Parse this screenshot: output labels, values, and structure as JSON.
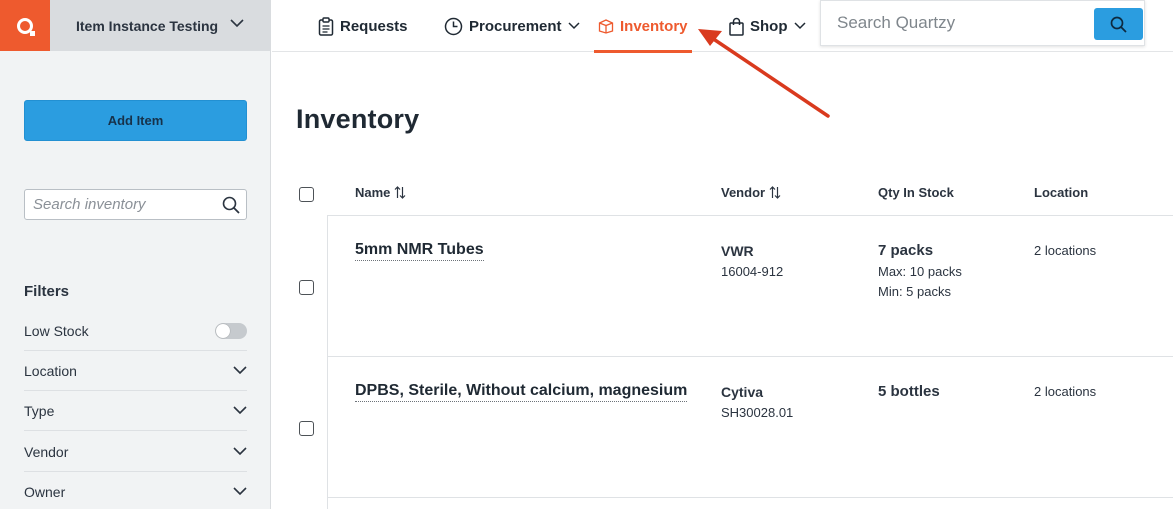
{
  "sidebar": {
    "logo_letter": "Q",
    "workspace_name": "Item Instance Testing",
    "add_item_label": "Add Item",
    "search_placeholder": "Search inventory",
    "filters_title": "Filters",
    "filters": [
      {
        "label": "Low Stock",
        "control": "toggle",
        "value": false
      },
      {
        "label": "Location",
        "control": "dropdown"
      },
      {
        "label": "Type",
        "control": "dropdown"
      },
      {
        "label": "Vendor",
        "control": "dropdown"
      },
      {
        "label": "Owner",
        "control": "dropdown"
      }
    ]
  },
  "topnav": {
    "items": [
      {
        "label": "Requests",
        "icon": "clipboard-icon"
      },
      {
        "label": "Procurement",
        "icon": "clock-icon",
        "has_dropdown": true
      },
      {
        "label": "Inventory",
        "icon": "box-icon",
        "active": true
      },
      {
        "label": "Shop",
        "icon": "shopping-bag-icon",
        "has_dropdown": true
      }
    ],
    "search_placeholder": "Search Quartzy"
  },
  "main": {
    "title": "Inventory",
    "columns": [
      "Name",
      "Vendor",
      "Qty In Stock",
      "Location"
    ],
    "rows": [
      {
        "name": "5mm NMR Tubes",
        "vendor": "VWR",
        "catalog": "16004-912",
        "qty": "7 packs",
        "max": "Max: 10 packs",
        "min": "Min: 5 packs",
        "location": "2 locations"
      },
      {
        "name": "DPBS, Sterile, Without calcium, magnesium",
        "vendor": "Cytiva",
        "catalog": "SH30028.01",
        "qty": "5 bottles",
        "location": "2 locations"
      }
    ]
  },
  "colors": {
    "brand_orange": "#ee5a2e",
    "primary_blue": "#2b9de0",
    "annotation_arrow": "#d93a1e"
  }
}
